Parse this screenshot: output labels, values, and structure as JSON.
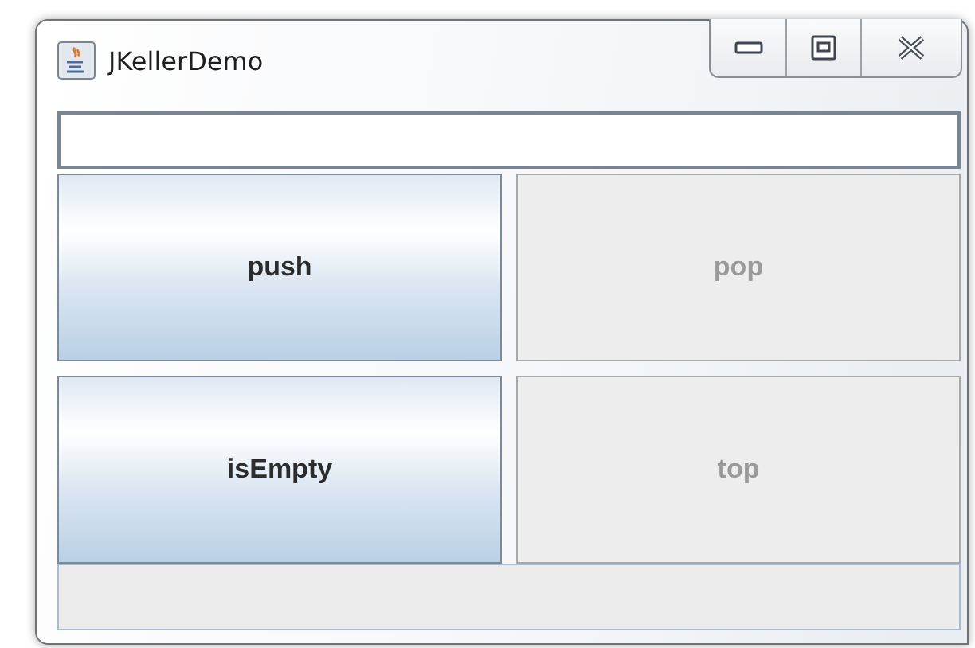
{
  "window": {
    "title": "JKellerDemo"
  },
  "buttons": [
    {
      "label": "push",
      "disabled": false
    },
    {
      "label": "pop",
      "disabled": true
    },
    {
      "label": "isEmpty",
      "disabled": false
    },
    {
      "label": "top",
      "disabled": true
    }
  ]
}
